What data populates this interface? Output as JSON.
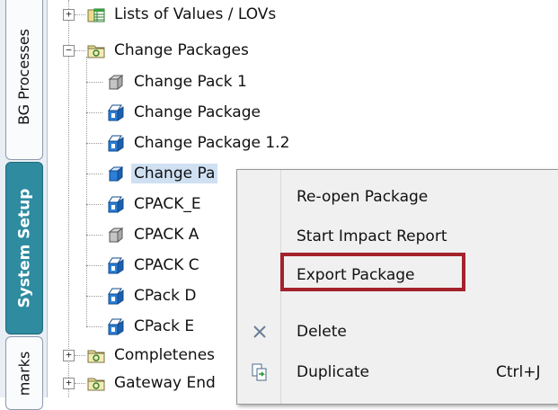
{
  "side_tabs": {
    "bg_processes": "BG Processes",
    "system_setup": "System Setup",
    "marks": "marks"
  },
  "tree": {
    "lists_of_values": "Lists of Values / LOVs",
    "change_packages": "Change Packages",
    "children": [
      "Change Pack 1",
      "Change Package",
      "Change Package 1.2",
      "Change Pa",
      "CPACK_E",
      "CPACK A",
      "CPACK C",
      "CPack D",
      "CPack E"
    ],
    "completeness": "Completenes",
    "gateway": "Gateway End"
  },
  "context_menu": {
    "reopen": "Re-open Package",
    "impact": "Start Impact Report",
    "export": "Export Package",
    "delete": "Delete",
    "duplicate": "Duplicate",
    "duplicate_shortcut": "Ctrl+J"
  },
  "icons": {
    "expand_plus": "+",
    "collapse_minus": "−"
  },
  "colors": {
    "active_tab": "#2e8ba0",
    "selection": "#cfe0f3",
    "highlight_border": "#a3222c",
    "package_blue": "#2b7fd6"
  }
}
